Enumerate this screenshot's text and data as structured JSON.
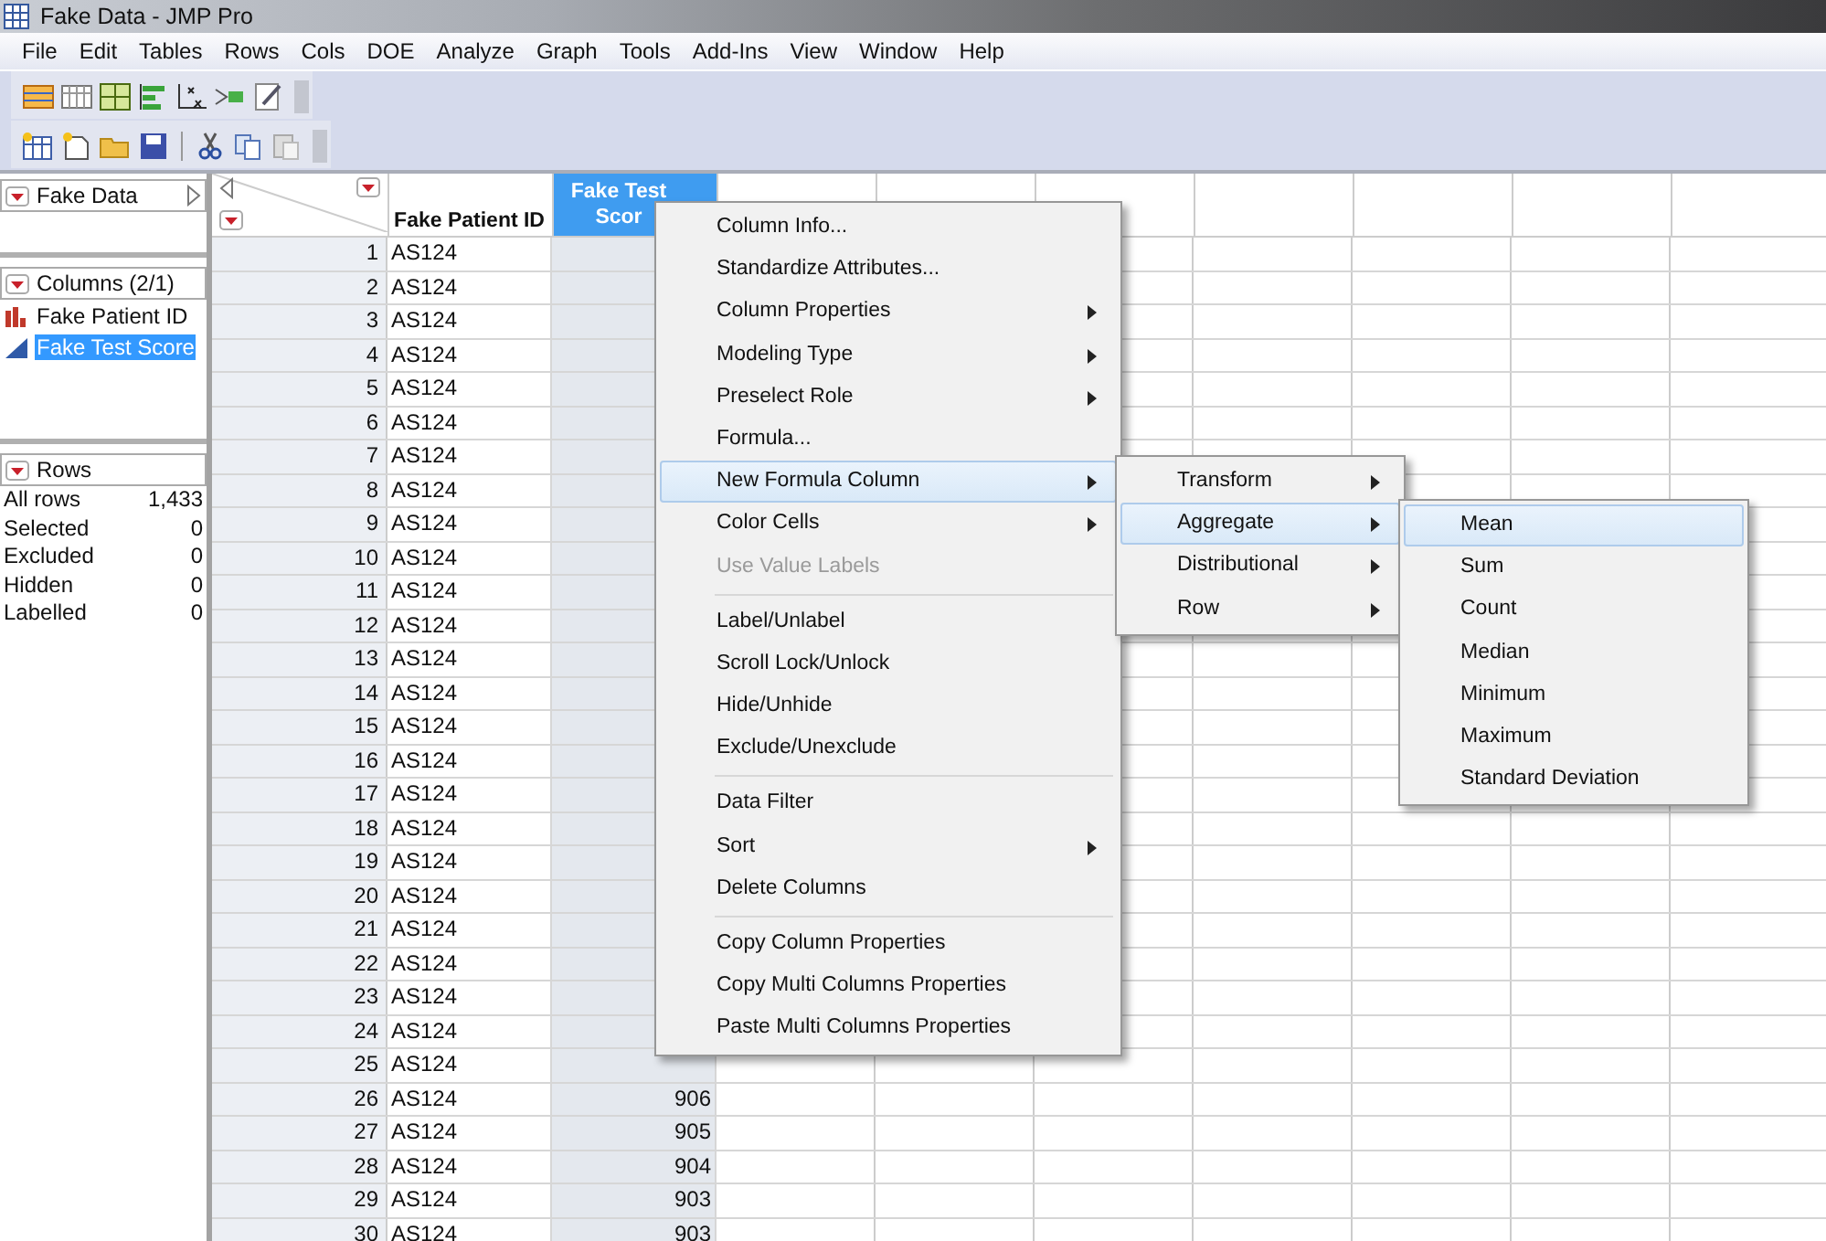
{
  "window": {
    "title": "Fake Data - JMP Pro"
  },
  "menu_bar": [
    "File",
    "Edit",
    "Tables",
    "Rows",
    "Cols",
    "DOE",
    "Analyze",
    "Graph",
    "Tools",
    "Add-Ins",
    "View",
    "Window",
    "Help"
  ],
  "table_panel": {
    "title": "Fake Data"
  },
  "columns_panel": {
    "title": "Columns (2/1)",
    "items": [
      {
        "name": "Fake Patient ID",
        "kind": "nominal",
        "selected": false
      },
      {
        "name": "Fake Test Score",
        "kind": "continuous",
        "selected": true
      }
    ]
  },
  "rows_panel": {
    "title": "Rows",
    "stats": [
      {
        "label": "All rows",
        "value": "1,433"
      },
      {
        "label": "Selected",
        "value": "0"
      },
      {
        "label": "Excluded",
        "value": "0"
      },
      {
        "label": "Hidden",
        "value": "0"
      },
      {
        "label": "Labelled",
        "value": "0"
      }
    ]
  },
  "table": {
    "columns": [
      {
        "name": "Fake Patient ID",
        "selected": false
      },
      {
        "name": "Fake Test Scor",
        "selected": true
      }
    ],
    "rows": [
      {
        "number": "1",
        "id": "AS124"
      },
      {
        "number": "2",
        "id": "AS124"
      },
      {
        "number": "3",
        "id": "AS124"
      },
      {
        "number": "4",
        "id": "AS124"
      },
      {
        "number": "5",
        "id": "AS124"
      },
      {
        "number": "6",
        "id": "AS124"
      },
      {
        "number": "7",
        "id": "AS124"
      },
      {
        "number": "8",
        "id": "AS124"
      },
      {
        "number": "9",
        "id": "AS124"
      },
      {
        "number": "10",
        "id": "AS124"
      },
      {
        "number": "11",
        "id": "AS124"
      },
      {
        "number": "12",
        "id": "AS124"
      },
      {
        "number": "13",
        "id": "AS124"
      },
      {
        "number": "14",
        "id": "AS124"
      },
      {
        "number": "15",
        "id": "AS124"
      },
      {
        "number": "16",
        "id": "AS124"
      },
      {
        "number": "17",
        "id": "AS124"
      },
      {
        "number": "18",
        "id": "AS124"
      },
      {
        "number": "19",
        "id": "AS124"
      },
      {
        "number": "20",
        "id": "AS124"
      },
      {
        "number": "21",
        "id": "AS124"
      },
      {
        "number": "22",
        "id": "AS124"
      },
      {
        "number": "23",
        "id": "AS124"
      },
      {
        "number": "24",
        "id": "AS124"
      },
      {
        "number": "25",
        "id": "AS124"
      },
      {
        "number": "26",
        "id": "AS124",
        "score": "906"
      },
      {
        "number": "27",
        "id": "AS124",
        "score": "905"
      },
      {
        "number": "28",
        "id": "AS124",
        "score": "904"
      },
      {
        "number": "29",
        "id": "AS124",
        "score": "903"
      },
      {
        "number": "30",
        "id": "AS124",
        "score": "903"
      }
    ]
  },
  "context_menu": {
    "items": [
      {
        "kind": "item",
        "label": "Column Info...",
        "submenu": false,
        "disabled": false,
        "selected": false
      },
      {
        "kind": "item",
        "label": "Standardize Attributes...",
        "submenu": false,
        "disabled": false,
        "selected": false
      },
      {
        "kind": "item",
        "label": "Column Properties",
        "submenu": true,
        "disabled": false,
        "selected": false
      },
      {
        "kind": "item",
        "label": "Modeling Type",
        "submenu": true,
        "disabled": false,
        "selected": false
      },
      {
        "kind": "item",
        "label": "Preselect Role",
        "submenu": true,
        "disabled": false,
        "selected": false
      },
      {
        "kind": "item",
        "label": "Formula...",
        "submenu": false,
        "disabled": false,
        "selected": false
      },
      {
        "kind": "item",
        "label": "New Formula Column",
        "submenu": true,
        "disabled": false,
        "selected": true
      },
      {
        "kind": "item",
        "label": "Color Cells",
        "submenu": true,
        "disabled": false,
        "selected": false
      },
      {
        "kind": "item",
        "label": "Use Value Labels",
        "submenu": false,
        "disabled": true,
        "selected": false
      },
      {
        "kind": "separator"
      },
      {
        "kind": "item",
        "label": "Label/Unlabel",
        "submenu": false,
        "disabled": false,
        "selected": false
      },
      {
        "kind": "item",
        "label": "Scroll Lock/Unlock",
        "submenu": false,
        "disabled": false,
        "selected": false
      },
      {
        "kind": "item",
        "label": "Hide/Unhide",
        "submenu": false,
        "disabled": false,
        "selected": false
      },
      {
        "kind": "item",
        "label": "Exclude/Unexclude",
        "submenu": false,
        "disabled": false,
        "selected": false
      },
      {
        "kind": "separator"
      },
      {
        "kind": "item",
        "label": "Data Filter",
        "submenu": false,
        "disabled": false,
        "selected": false
      },
      {
        "kind": "item",
        "label": "Sort",
        "submenu": true,
        "disabled": false,
        "selected": false
      },
      {
        "kind": "item",
        "label": "Delete Columns",
        "submenu": false,
        "disabled": false,
        "selected": false
      },
      {
        "kind": "separator"
      },
      {
        "kind": "item",
        "label": "Copy Column Properties",
        "submenu": false,
        "disabled": false,
        "selected": false
      },
      {
        "kind": "item",
        "label": "Copy Multi Columns Properties",
        "submenu": false,
        "disabled": false,
        "selected": false
      },
      {
        "kind": "item",
        "label": "Paste Multi Columns Properties",
        "submenu": false,
        "disabled": false,
        "selected": false
      }
    ]
  },
  "formula_submenu": {
    "items": [
      {
        "kind": "item",
        "label": "Transform",
        "submenu": true,
        "disabled": false,
        "selected": false
      },
      {
        "kind": "item",
        "label": "Aggregate",
        "submenu": true,
        "disabled": false,
        "selected": true
      },
      {
        "kind": "item",
        "label": "Distributional",
        "submenu": true,
        "disabled": false,
        "selected": false
      },
      {
        "kind": "item",
        "label": "Row",
        "submenu": true,
        "disabled": false,
        "selected": false
      }
    ]
  },
  "aggregate_submenu": {
    "items": [
      {
        "kind": "item",
        "label": "Mean",
        "submenu": false,
        "disabled": false,
        "selected": true
      },
      {
        "kind": "item",
        "label": "Sum",
        "submenu": false,
        "disabled": false,
        "selected": false
      },
      {
        "kind": "item",
        "label": "Count",
        "submenu": false,
        "disabled": false,
        "selected": false
      },
      {
        "kind": "item",
        "label": "Median",
        "submenu": false,
        "disabled": false,
        "selected": false
      },
      {
        "kind": "item",
        "label": "Minimum",
        "submenu": false,
        "disabled": false,
        "selected": false
      },
      {
        "kind": "item",
        "label": "Maximum",
        "submenu": false,
        "disabled": false,
        "selected": false
      },
      {
        "kind": "item",
        "label": "Standard Deviation",
        "submenu": false,
        "disabled": false,
        "selected": false
      }
    ]
  }
}
